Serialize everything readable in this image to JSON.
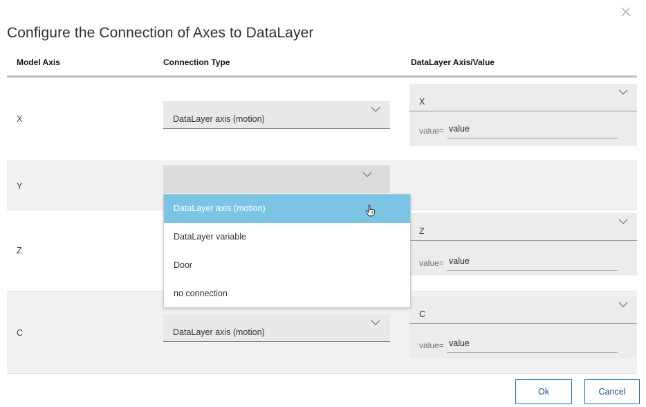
{
  "dialog": {
    "title": "Configure the Connection of Axes to DataLayer",
    "close_icon": "close-icon"
  },
  "columns": [
    "Model Axis",
    "Connection Type",
    "DataLayer Axis/Value"
  ],
  "rows": [
    {
      "axis": "X",
      "connection": "DataLayer axis (motion)",
      "dl_axis": "X",
      "value_label": "value=",
      "value": "value"
    },
    {
      "axis": "Y",
      "connection": "",
      "dl_axis": "",
      "value_label": "",
      "value": ""
    },
    {
      "axis": "Z",
      "connection": "",
      "dl_axis": "Z",
      "value_label": "value=",
      "value": "value"
    },
    {
      "axis": "C",
      "connection": "DataLayer axis (motion)",
      "dl_axis": "C",
      "value_label": "value=",
      "value": "value"
    }
  ],
  "dropdown": {
    "open_for_row": "Y",
    "options": [
      "DataLayer axis (motion)",
      "DataLayer variable",
      "Door",
      "no connection"
    ],
    "highlighted": "DataLayer axis (motion)"
  },
  "buttons": {
    "ok": "Ok",
    "cancel": "Cancel"
  },
  "colors": {
    "highlight": "#7cc4e4",
    "button_border": "#1b6fb0",
    "row_grey": "#f2f2f2"
  }
}
